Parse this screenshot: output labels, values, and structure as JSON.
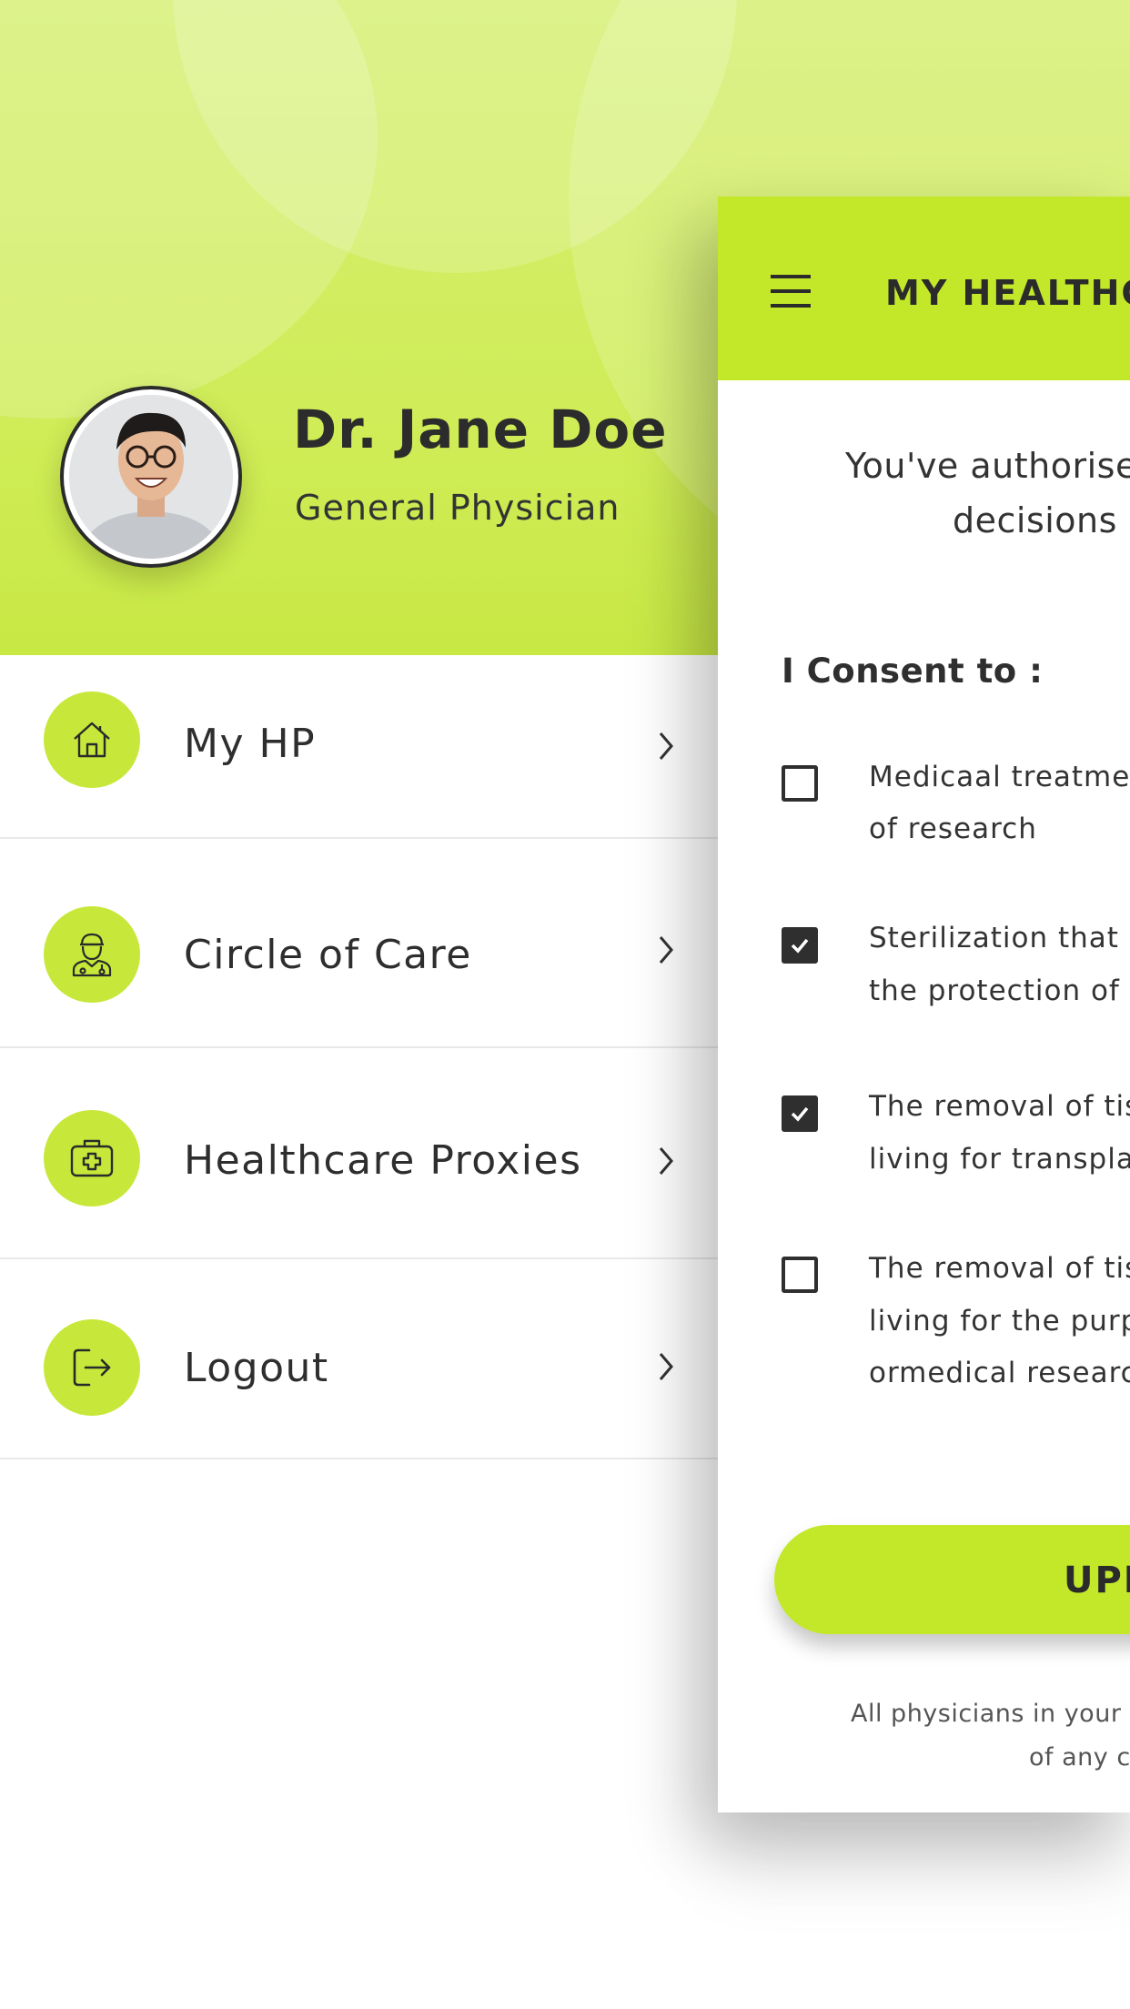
{
  "theme": {
    "accent": "#c2e829",
    "accent_light": "#cfec55",
    "text": "#2f2f2f",
    "divider": "#e9e9e9"
  },
  "profile": {
    "name": "Dr. Jane Doe",
    "role": "General Physician",
    "avatar_icon": "user-photo"
  },
  "menu": {
    "items": [
      {
        "label": "My HP",
        "icon": "home-icon"
      },
      {
        "label": "Circle of Care",
        "icon": "doctor-icon"
      },
      {
        "label": "Healthcare Proxies",
        "icon": "medical-kit-icon"
      },
      {
        "label": "Logout",
        "icon": "logout-icon"
      }
    ]
  },
  "panel": {
    "title": "MY HEALTHC",
    "authorised_line1": "You've authorise",
    "authorised_line2": "decisions",
    "consent_title": "I Consent to :",
    "options": [
      {
        "checked": false,
        "line1": "Medicaal treatme",
        "line2": "of research",
        "line3": ""
      },
      {
        "checked": true,
        "line1": "Sterilization that",
        "line2": "the protection of",
        "line3": ""
      },
      {
        "checked": true,
        "line1": "The removal of tis",
        "line2": "living for transpla",
        "line3": ""
      },
      {
        "checked": false,
        "line1": "The removal of tis",
        "line2": "living for the purp",
        "line3": "ormedical researc"
      }
    ],
    "update_label": "UPI",
    "footer_line1": "All physicians in your c",
    "footer_line2": "of any c"
  }
}
